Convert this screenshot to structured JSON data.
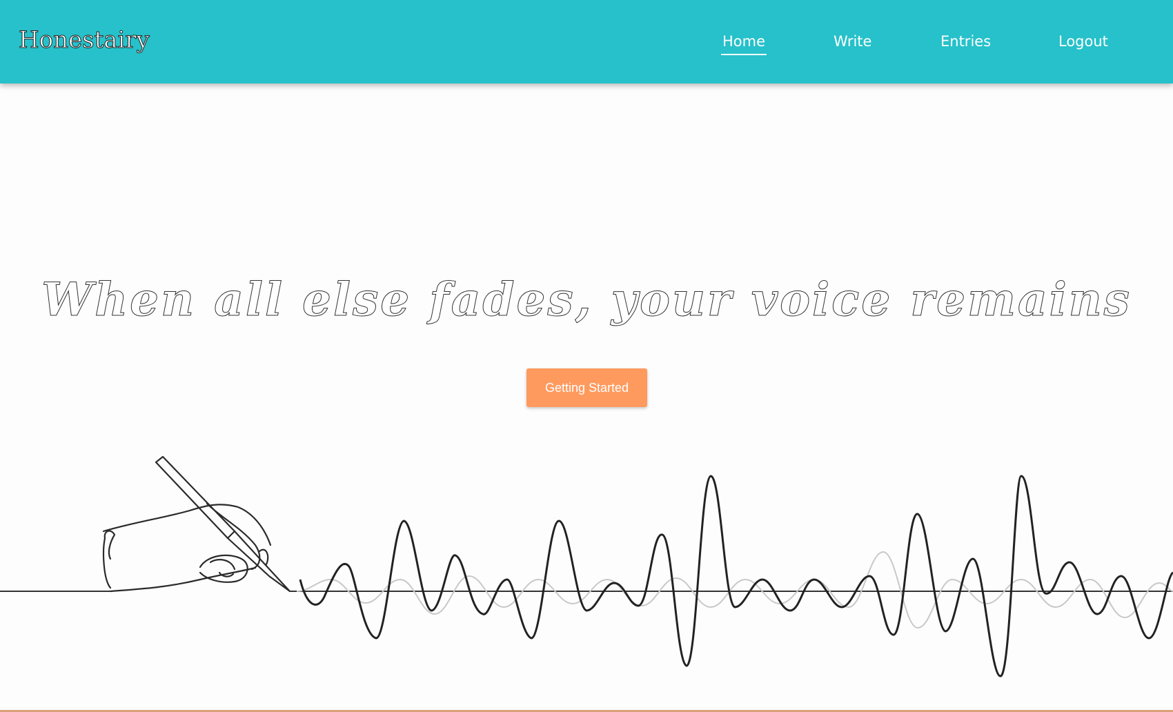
{
  "brand": {
    "name": "Honestairy"
  },
  "nav": {
    "items": [
      {
        "label": "Home",
        "active": true
      },
      {
        "label": "Write",
        "active": false
      },
      {
        "label": "Entries",
        "active": false
      },
      {
        "label": "Logout",
        "active": false
      }
    ]
  },
  "hero": {
    "tagline": "When all else fades, your voice remains",
    "cta_label": "Getting Started"
  },
  "colors": {
    "navbar": "#26c1ca",
    "cta": "#ff9a5e",
    "text_on_nav": "#ffffff"
  },
  "icons": {
    "illustration": "hand-writing-soundwave-illustration"
  }
}
